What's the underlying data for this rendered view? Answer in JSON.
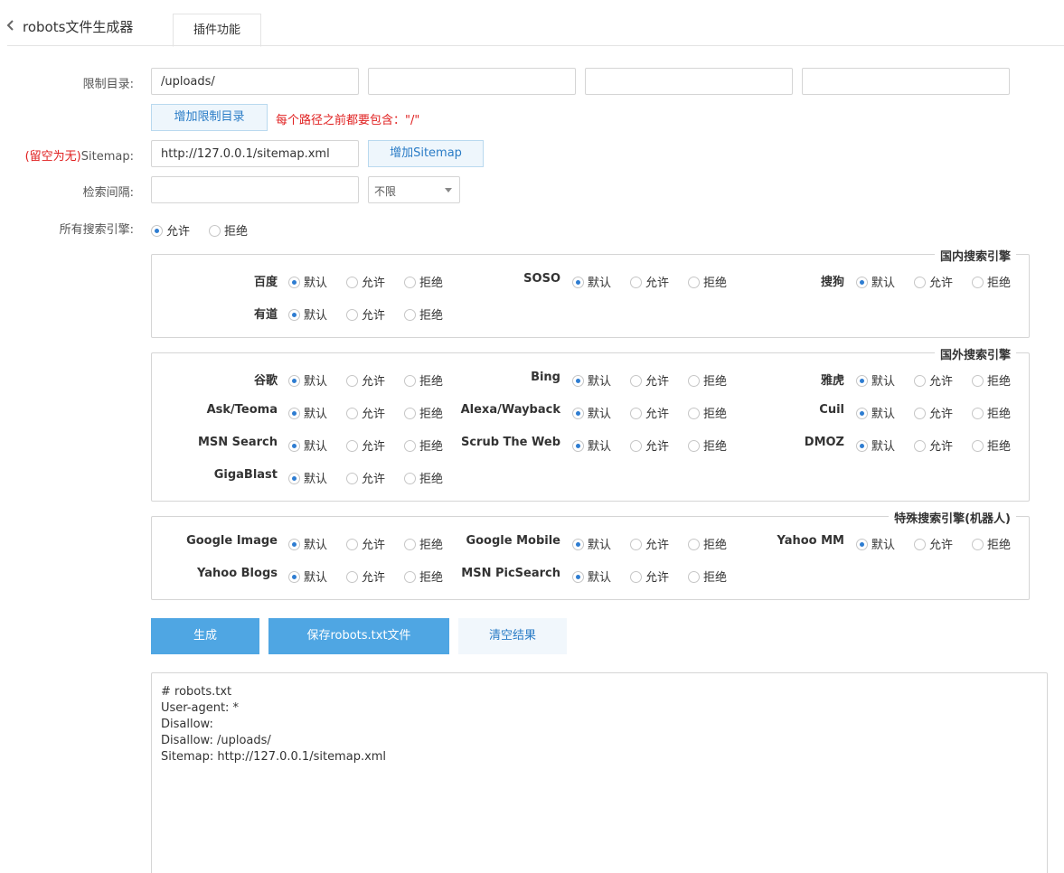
{
  "app": {
    "title": "robots文件生成器",
    "tab": "插件功能"
  },
  "colors": {
    "accent": "#4fa6e3",
    "hint_red": "#e02020"
  },
  "icons": {
    "back": "chevron-left-icon"
  },
  "form": {
    "restrict_label": "限制目录:",
    "restrict_values": [
      "/uploads/",
      "",
      "",
      ""
    ],
    "add_restrict_btn": "增加限制目录",
    "restrict_hint": "每个路径之前都要包含：\"/\"",
    "sitemap_label_red": "(留空为无)",
    "sitemap_label": "Sitemap:",
    "sitemap_value": "http://127.0.0.1/sitemap.xml",
    "add_sitemap_btn": "增加Sitemap",
    "interval_label": "检索间隔:",
    "interval_value": "",
    "interval_select": "不限",
    "all_engines_label": "所有搜索引擎:",
    "all_engines_allow": "允许",
    "all_engines_deny": "拒绝",
    "all_engines_selected": "允许"
  },
  "options": {
    "default": "默认",
    "allow": "允许",
    "deny": "拒绝"
  },
  "groups": [
    {
      "title": "国内搜索引擎",
      "engines": [
        {
          "name": "百度",
          "selected": "default"
        },
        {
          "name": "SOSO",
          "selected": "default"
        },
        {
          "name": "搜狗",
          "selected": "default"
        },
        {
          "name": "有道",
          "selected": "default"
        }
      ]
    },
    {
      "title": "国外搜索引擎",
      "engines": [
        {
          "name": "谷歌",
          "selected": "default"
        },
        {
          "name": "Bing",
          "selected": "default"
        },
        {
          "name": "雅虎",
          "selected": "default"
        },
        {
          "name": "Ask/Teoma",
          "selected": "default"
        },
        {
          "name": "Alexa/Wayback",
          "selected": "default"
        },
        {
          "name": "Cuil",
          "selected": "default"
        },
        {
          "name": "MSN Search",
          "selected": "default"
        },
        {
          "name": "Scrub The Web",
          "selected": "default"
        },
        {
          "name": "DMOZ",
          "selected": "default"
        },
        {
          "name": "GigaBlast",
          "selected": "default"
        }
      ]
    },
    {
      "title": "特殊搜索引擎(机器人)",
      "engines": [
        {
          "name": "Google Image",
          "selected": "default"
        },
        {
          "name": "Google Mobile",
          "selected": "default"
        },
        {
          "name": "Yahoo MM",
          "selected": "default"
        },
        {
          "name": "Yahoo Blogs",
          "selected": "default"
        },
        {
          "name": "MSN PicSearch",
          "selected": "default"
        }
      ]
    }
  ],
  "actions": {
    "generate": "生成",
    "save": "保存robots.txt文件",
    "clear": "清空结果"
  },
  "output": "# robots.txt\nUser-agent: *\nDisallow:\nDisallow: /uploads/\nSitemap: http://127.0.0.1/sitemap.xml"
}
